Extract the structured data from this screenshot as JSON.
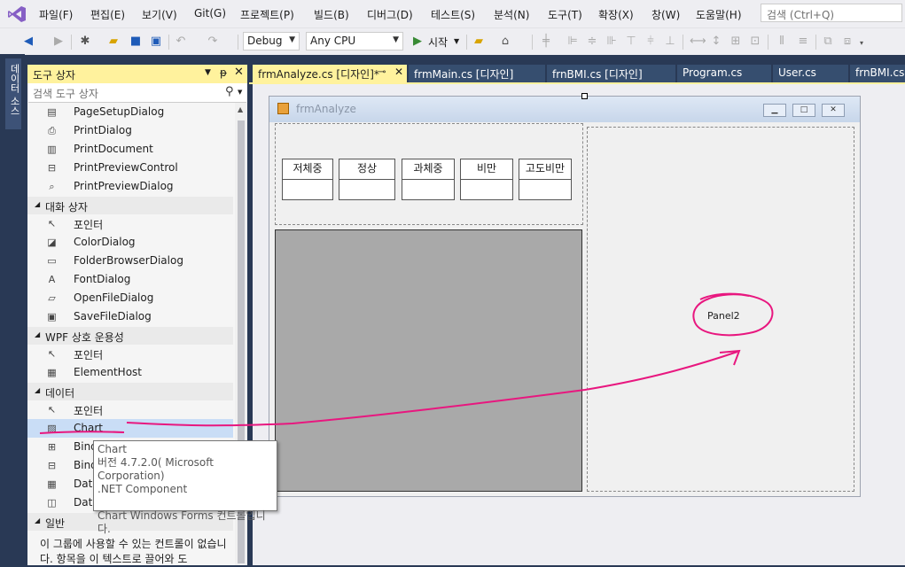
{
  "menu": {
    "items": [
      "파일(F)",
      "편집(E)",
      "보기(V)",
      "Git(G)",
      "프로젝트(P)",
      "빌드(B)",
      "디버그(D)",
      "테스트(S)",
      "분석(N)",
      "도구(T)",
      "확장(X)",
      "창(W)",
      "도움말(H)"
    ],
    "search_placeholder": "검색 (Ctrl+Q)"
  },
  "toolbar": {
    "config": "Debug",
    "platform": "Any CPU",
    "start_label": "시작"
  },
  "side_tab": "데이터 소스",
  "toolbox": {
    "title": "도구 상자",
    "search_placeholder": "검색 도구 상자",
    "items": [
      {
        "kind": "item",
        "label": "PageSetupDialog",
        "icon": "page-setup-icon"
      },
      {
        "kind": "item",
        "label": "PrintDialog",
        "icon": "printer-icon"
      },
      {
        "kind": "item",
        "label": "PrintDocument",
        "icon": "print-document-icon"
      },
      {
        "kind": "item",
        "label": "PrintPreviewControl",
        "icon": "print-preview-icon"
      },
      {
        "kind": "item",
        "label": "PrintPreviewDialog",
        "icon": "print-preview-dialog-icon"
      },
      {
        "kind": "group",
        "label": "대화 상자"
      },
      {
        "kind": "item",
        "label": "포인터",
        "icon": "pointer-icon"
      },
      {
        "kind": "item",
        "label": "ColorDialog",
        "icon": "color-dialog-icon"
      },
      {
        "kind": "item",
        "label": "FolderBrowserDialog",
        "icon": "folder-icon"
      },
      {
        "kind": "item",
        "label": "FontDialog",
        "icon": "font-icon"
      },
      {
        "kind": "item",
        "label": "OpenFileDialog",
        "icon": "open-file-icon"
      },
      {
        "kind": "item",
        "label": "SaveFileDialog",
        "icon": "save-file-icon"
      },
      {
        "kind": "group",
        "label": "WPF 상호 운용성"
      },
      {
        "kind": "item",
        "label": "포인터",
        "icon": "pointer-icon"
      },
      {
        "kind": "item",
        "label": "ElementHost",
        "icon": "element-host-icon"
      },
      {
        "kind": "group",
        "label": "데이터"
      },
      {
        "kind": "item",
        "label": "포인터",
        "icon": "pointer-icon"
      },
      {
        "kind": "item",
        "label": "Chart",
        "icon": "chart-icon",
        "selected": true
      },
      {
        "kind": "item",
        "label": "BindingNavigator",
        "icon": "binding-navigator-icon"
      },
      {
        "kind": "item",
        "label": "BindingSource",
        "icon": "binding-source-icon"
      },
      {
        "kind": "item",
        "label": "DataGridView",
        "icon": "datagrid-icon"
      },
      {
        "kind": "item",
        "label": "DataSet",
        "icon": "dataset-icon"
      },
      {
        "kind": "group",
        "label": "일반"
      }
    ],
    "empty_text": "이 그룹에 사용할 수 있는 컨트롤이 없습니다. 항목을 이 텍스트로 끌어와 도"
  },
  "tooltip": {
    "line1": "Chart",
    "line2": "버전 4.7.2.0( Microsoft Corporation)",
    "line3": ".NET Component",
    "line4": "Chart Windows Forms 컨트롤입니다."
  },
  "tabs": [
    {
      "label": "frmAnalyze.cs [디자인]*",
      "active": true
    },
    {
      "label": "frmMain.cs [디자인]"
    },
    {
      "label": "frnBMI.cs [디자인]"
    },
    {
      "label": "Program.cs"
    },
    {
      "label": "User.cs"
    },
    {
      "label": "frnBMI.cs"
    }
  ],
  "form": {
    "title": "frmAnalyze",
    "categories": [
      "저체중",
      "정상",
      "과체중",
      "비만",
      "고도비만"
    ],
    "panel2_label": "Panel2"
  },
  "colors": {
    "accent_yellow": "#fff29d",
    "annotation": "#e8177f",
    "vs_blue": "#293955"
  }
}
